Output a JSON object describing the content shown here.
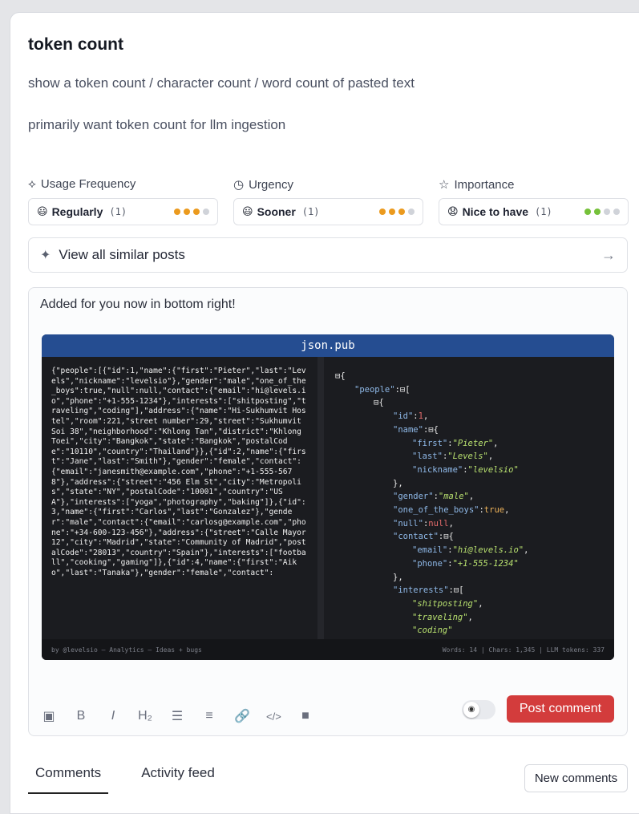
{
  "post": {
    "title": "token count",
    "description_1": "show a token count / character count / word count of pasted text",
    "description_2": "primarily want token count for llm ingestion"
  },
  "metrics": [
    {
      "label": "Usage Frequency",
      "icon": "pulse-icon",
      "emoji": "😃",
      "value": "Regularly",
      "count": "(1)",
      "level": 3,
      "max": 4,
      "color": "#eb9a1e"
    },
    {
      "label": "Urgency",
      "icon": "clock-icon",
      "emoji": "😃",
      "value": "Sooner",
      "count": "(1)",
      "level": 3,
      "max": 4,
      "color": "#eb9a1e"
    },
    {
      "label": "Importance",
      "icon": "star-icon",
      "emoji": "😧",
      "value": "Nice to have",
      "count": "(1)",
      "level": 2,
      "max": 4,
      "color": "#76c13a"
    }
  ],
  "similar": {
    "label": "View all similar posts"
  },
  "comment": {
    "text": "Added for you now in bottom right!",
    "screenshot": {
      "header": "json.pub",
      "raw_json": "{\"people\":[{\"id\":1,\"name\":{\"first\":\"Pieter\",\"last\":\"Levels\",\"nickname\":\"levelsio\"},\"gender\":\"male\",\"one_of_the_boys\":true,\"null\":null,\"contact\":{\"email\":\"hi@levels.io\",\"phone\":\"+1-555-1234\"},\"interests\":[\"shitposting\",\"traveling\",\"coding\"],\"address\":{\"name\":\"Hi-Sukhumvit Hostel\",\"room\":221,\"street number\":29,\"street\":\"Sukhumvit Soi 38\",\"neighborhood\":\"Khlong Tan\",\"district\":\"Khlong Toei\",\"city\":\"Bangkok\",\"state\":\"Bangkok\",\"postalCode\":\"10110\",\"country\":\"Thailand\"}},{\"id\":2,\"name\":{\"first\":\"Jane\",\"last\":\"Smith\"},\"gender\":\"female\",\"contact\":{\"email\":\"janesmith@example.com\",\"phone\":\"+1-555-5678\"},\"address\":{\"street\":\"456 Elm St\",\"city\":\"Metropolis\",\"state\":\"NY\",\"postalCode\":\"10001\",\"country\":\"USA\"},\"interests\":[\"yoga\",\"photography\",\"baking\"]},{\"id\":3,\"name\":{\"first\":\"Carlos\",\"last\":\"Gonzalez\"},\"gender\":\"male\",\"contact\":{\"email\":\"carlosg@example.com\",\"phone\":\"+34-600-123-456\"},\"address\":{\"street\":\"Calle Mayor 12\",\"city\":\"Madrid\",\"state\":\"Community of Madrid\",\"postalCode\":\"28013\",\"country\":\"Spain\"},\"interests\":[\"football\",\"cooking\",\"gaming\"]},{\"id\":4,\"name\":{\"first\":\"Aiko\",\"last\":\"Tanaka\"},\"gender\":\"female\",\"contact\":",
      "tree": [
        {
          "indent": 0,
          "parts": [
            [
              "p",
              "⊟{"
            ]
          ]
        },
        {
          "indent": 1,
          "parts": [
            [
              "k",
              "\"people\""
            ],
            [
              "p",
              ":⊟["
            ]
          ]
        },
        {
          "indent": 2,
          "parts": [
            [
              "p",
              "⊟{"
            ]
          ]
        },
        {
          "indent": 3,
          "parts": [
            [
              "k",
              "\"id\""
            ],
            [
              "p",
              ":"
            ],
            [
              "n",
              "1"
            ],
            [
              "p",
              ","
            ]
          ]
        },
        {
          "indent": 3,
          "parts": [
            [
              "k",
              "\"name\""
            ],
            [
              "p",
              ":⊟{"
            ]
          ]
        },
        {
          "indent": 4,
          "parts": [
            [
              "k",
              "\"first\""
            ],
            [
              "p",
              ":"
            ],
            [
              "s",
              "\"Pieter\""
            ],
            [
              "p",
              ","
            ]
          ]
        },
        {
          "indent": 4,
          "parts": [
            [
              "k",
              "\"last\""
            ],
            [
              "p",
              ":"
            ],
            [
              "s",
              "\"Levels\""
            ],
            [
              "p",
              ","
            ]
          ]
        },
        {
          "indent": 4,
          "parts": [
            [
              "k",
              "\"nickname\""
            ],
            [
              "p",
              ":"
            ],
            [
              "s",
              "\"levelsio\""
            ]
          ]
        },
        {
          "indent": 3,
          "parts": [
            [
              "p",
              "},"
            ]
          ]
        },
        {
          "indent": 3,
          "parts": [
            [
              "k",
              "\"gender\""
            ],
            [
              "p",
              ":"
            ],
            [
              "s",
              "\"male\""
            ],
            [
              "p",
              ","
            ]
          ]
        },
        {
          "indent": 3,
          "parts": [
            [
              "k",
              "\"one_of_the_boys\""
            ],
            [
              "p",
              ":"
            ],
            [
              "b",
              "true"
            ],
            [
              "p",
              ","
            ]
          ]
        },
        {
          "indent": 3,
          "parts": [
            [
              "k",
              "\"null\""
            ],
            [
              "p",
              ":"
            ],
            [
              "n",
              "null"
            ],
            [
              "p",
              ","
            ]
          ]
        },
        {
          "indent": 3,
          "parts": [
            [
              "k",
              "\"contact\""
            ],
            [
              "p",
              ":⊟{"
            ]
          ]
        },
        {
          "indent": 4,
          "parts": [
            [
              "k",
              "\"email\""
            ],
            [
              "p",
              ":"
            ],
            [
              "s",
              "\"hi@levels.io\""
            ],
            [
              "p",
              ","
            ]
          ]
        },
        {
          "indent": 4,
          "parts": [
            [
              "k",
              "\"phone\""
            ],
            [
              "p",
              ":"
            ],
            [
              "s",
              "\"+1-555-1234\""
            ]
          ]
        },
        {
          "indent": 3,
          "parts": [
            [
              "p",
              "},"
            ]
          ]
        },
        {
          "indent": 3,
          "parts": [
            [
              "k",
              "\"interests\""
            ],
            [
              "p",
              ":⊟["
            ]
          ]
        },
        {
          "indent": 4,
          "parts": [
            [
              "s",
              "\"shitposting\""
            ],
            [
              "p",
              ","
            ]
          ]
        },
        {
          "indent": 4,
          "parts": [
            [
              "s",
              "\"traveling\""
            ],
            [
              "p",
              ","
            ]
          ]
        },
        {
          "indent": 4,
          "parts": [
            [
              "s",
              "\"coding\""
            ]
          ]
        },
        {
          "indent": 3,
          "parts": [
            [
              "p",
              "],"
            ]
          ]
        }
      ],
      "footer_left": "by @levelsio — Analytics — Ideas + bugs",
      "footer_stats": "Words: 14  |  Chars: 1,345  |  LLM tokens: 337"
    }
  },
  "toolbar": {
    "icons": [
      "image-icon",
      "bold-icon",
      "italic-icon",
      "heading-icon",
      "bullet-list-icon",
      "numbered-list-icon",
      "link-icon",
      "code-icon",
      "video-icon"
    ],
    "glyphs": [
      "▣",
      "B",
      "I",
      "H₂",
      "☰",
      "≡",
      "🔗",
      "</>",
      "■"
    ]
  },
  "post_button": {
    "label": "Post comment"
  },
  "tabs": [
    {
      "label": "Comments",
      "active": true
    },
    {
      "label": "Activity feed",
      "active": false
    }
  ],
  "new_comments": {
    "label": "New comments"
  }
}
